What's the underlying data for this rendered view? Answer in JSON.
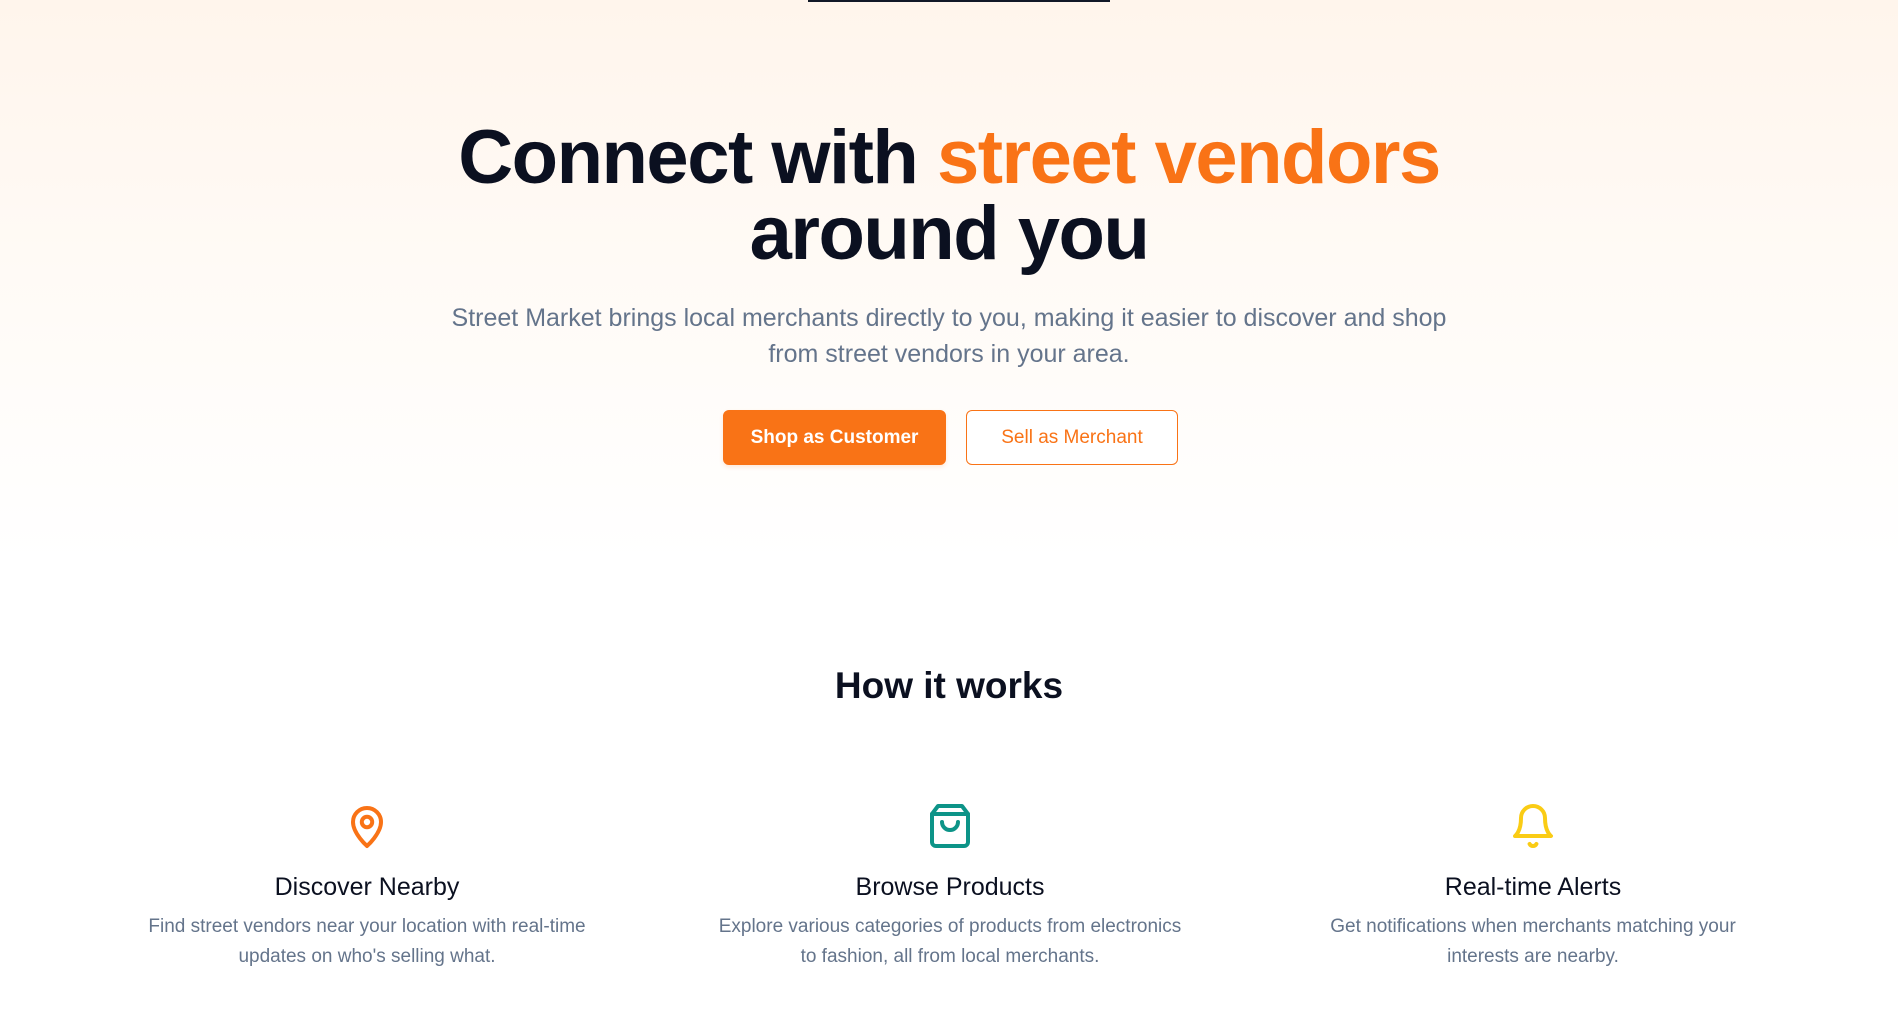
{
  "hero": {
    "title_part1": "Connect with",
    "title_accent": "street vendors",
    "title_part2": "around you",
    "subtitle": "Street Market brings local merchants directly to you, making it easier to discover and shop from street vendors in your area.",
    "primary_button": "Shop as Customer",
    "secondary_button": "Sell as Merchant"
  },
  "how_it_works": {
    "title": "How it works",
    "features": [
      {
        "icon": "map-pin-icon",
        "icon_color": "#f97316",
        "title": "Discover Nearby",
        "description": "Find street vendors near your location with real-time updates on who's selling what."
      },
      {
        "icon": "shopping-bag-icon",
        "icon_color": "#0d9488",
        "title": "Browse Products",
        "description": "Explore various categories of products from electronics to fashion, all from local merchants."
      },
      {
        "icon": "bell-icon",
        "icon_color": "#facc15",
        "title": "Real-time Alerts",
        "description": "Get notifications when merchants matching your interests are nearby."
      }
    ]
  },
  "colors": {
    "accent": "#f97316",
    "text_dark": "#0b1020",
    "text_muted": "#64748b"
  }
}
